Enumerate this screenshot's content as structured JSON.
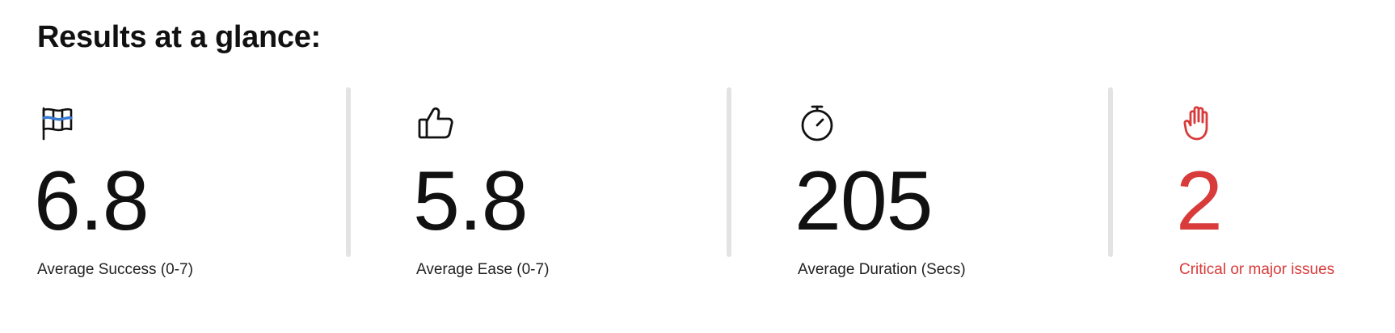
{
  "header": {
    "title": "Results at a glance:"
  },
  "stats": [
    {
      "icon": "checkered-flag-icon",
      "value": "6.8",
      "label": "Average Success (0-7)"
    },
    {
      "icon": "thumbs-up-icon",
      "value": "5.8",
      "label": "Average Ease (0-7)"
    },
    {
      "icon": "stopwatch-icon",
      "value": "205",
      "label": "Average Duration (Secs)"
    },
    {
      "icon": "raised-hand-icon",
      "value": "2",
      "label": "Critical or major issues"
    }
  ],
  "colors": {
    "text": "#111111",
    "alert": "#d93a3a",
    "accent": "#3a7bd5",
    "divider": "#e3e3e3"
  }
}
